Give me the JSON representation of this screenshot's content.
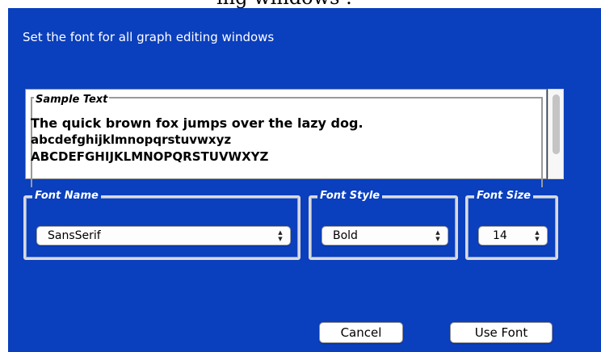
{
  "dialog": {
    "top_fragment": "ing windows .",
    "instruction": "Set the font for all graph editing windows",
    "colors": {
      "panel_bg": "#0a3fbd",
      "text": "#ffffff"
    }
  },
  "sample": {
    "legend": "Sample Text",
    "lines": [
      "The quick brown fox jumps over the lazy dog.",
      "abcdefghijklmnopqrstuvwxyz",
      "ABCDEFGHIJKLMNOPQRSTUVWXYZ"
    ]
  },
  "font_name": {
    "legend": "Font Name",
    "selected": "SansSerif"
  },
  "font_style": {
    "legend": "Font Style",
    "selected": "Bold"
  },
  "font_size": {
    "legend": "Font Size",
    "selected": "14"
  },
  "buttons": {
    "cancel": "Cancel",
    "use_font": "Use Font"
  },
  "icons": {
    "select_arrows": "up-down-chevron-icon"
  }
}
